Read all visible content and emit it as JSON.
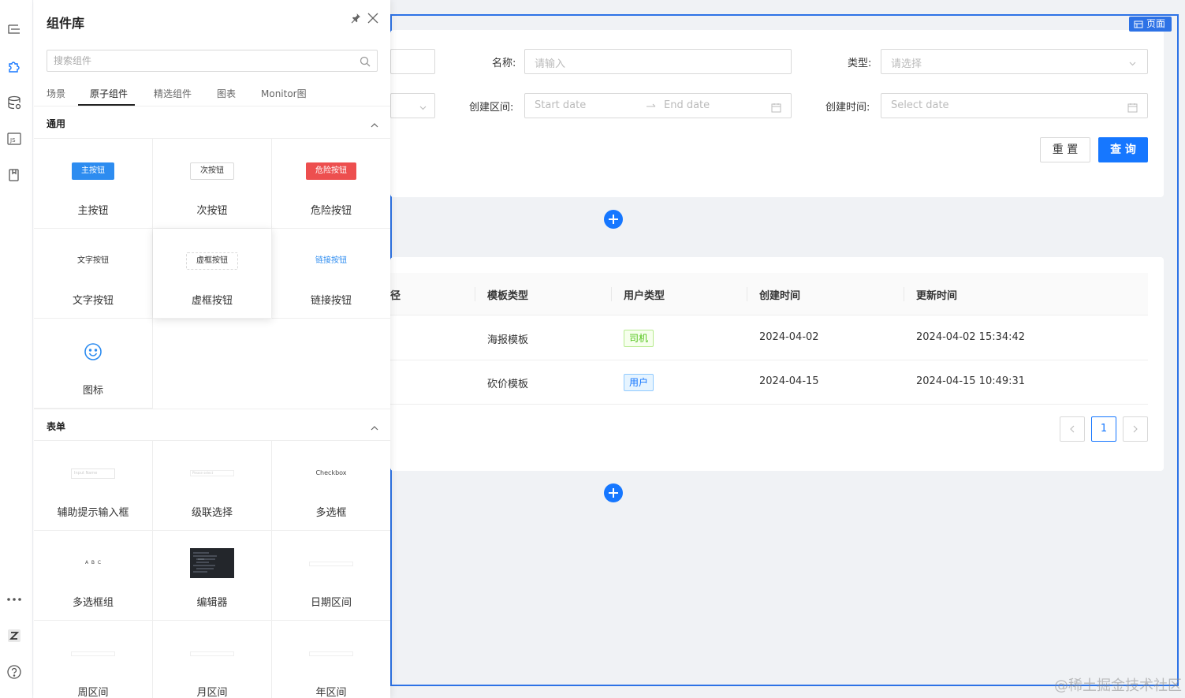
{
  "panel": {
    "title": "组件库",
    "search_placeholder": "搜索组件",
    "tabs": [
      {
        "label": "场景",
        "active": false
      },
      {
        "label": "原子组件",
        "active": true
      },
      {
        "label": "精选组件",
        "active": false
      },
      {
        "label": "图表",
        "active": false
      },
      {
        "label": "Monitor图",
        "active": false
      }
    ],
    "sections": {
      "general": {
        "title": "通用",
        "items": [
          {
            "caption": "主按钮",
            "preview": "主按钮"
          },
          {
            "caption": "次按钮",
            "preview": "次按钮"
          },
          {
            "caption": "危险按钮",
            "preview": "危险按钮"
          },
          {
            "caption": "文字按钮",
            "preview": "文字按钮"
          },
          {
            "caption": "虚框按钮",
            "preview": "虚框按钮"
          },
          {
            "caption": "链接按钮",
            "preview": "链接按钮"
          },
          {
            "caption": "图标",
            "preview": "smile-icon"
          }
        ]
      },
      "form": {
        "title": "表单",
        "items": [
          {
            "caption": "辅助提示输入框",
            "preview": "Input Name"
          },
          {
            "caption": "级联选择",
            "preview": "Please select"
          },
          {
            "caption": "多选框",
            "preview": "Checkbox"
          },
          {
            "caption": "多选框组",
            "preview": "A  B  C"
          },
          {
            "caption": "编辑器",
            "preview": "code-editor"
          },
          {
            "caption": "日期区间",
            "preview": "date-range"
          },
          {
            "caption": "周区间",
            "preview": "week-range"
          },
          {
            "caption": "月区间",
            "preview": "month-range"
          },
          {
            "caption": "年区间",
            "preview": "year-range"
          }
        ]
      }
    }
  },
  "page": {
    "badge": "页面",
    "form": {
      "name_label": "名称:",
      "name_placeholder": "请输入",
      "type_label": "类型:",
      "type_placeholder": "请选择",
      "range_label": "创建区间:",
      "range_start_placeholder": "Start date",
      "range_end_placeholder": "End date",
      "created_label": "创建时间:",
      "created_placeholder": "Select date",
      "reset_label": "重 置",
      "query_label": "查 询"
    },
    "table": {
      "columns": [
        "径",
        "模板类型",
        "用户类型",
        "创建时间",
        "更新时间"
      ],
      "rows": [
        {
          "template_type": "海报模板",
          "user_type": "司机",
          "created": "2024-04-02",
          "updated": "2024-04-02 15:34:42"
        },
        {
          "template_type": "砍价模板",
          "user_type": "用户",
          "created": "2024-04-15",
          "updated": "2024-04-15 10:49:31"
        }
      ],
      "pagination": {
        "current": "1"
      }
    }
  },
  "watermark": "@稀土掘金技术社区",
  "colors": {
    "accent": "#1677ff",
    "frame": "#2d72e6",
    "danger": "#ed4f4f"
  }
}
